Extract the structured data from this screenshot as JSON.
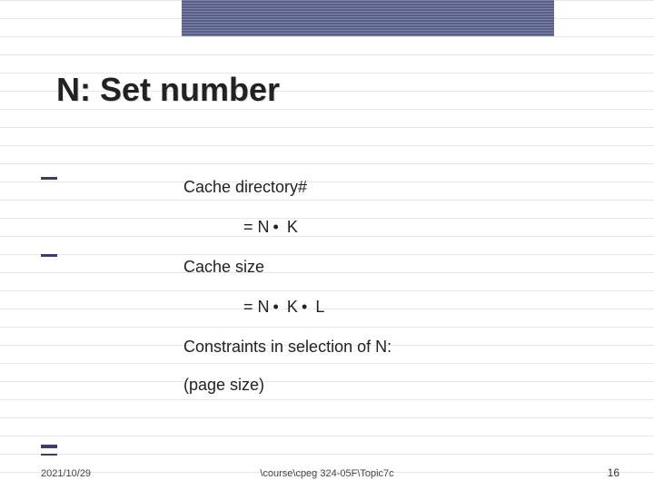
{
  "title": "N: Set number",
  "lines": {
    "l1": "Cache directory#",
    "l2_pre": "= N",
    "l2_post": " K",
    "l3": "Cache size",
    "l4_pre": "= N",
    "l4_mid": " K",
    "l4_post": " L",
    "l5": "Constraints in selection of N:",
    "l6": "(page size)"
  },
  "bullet": "•",
  "footer": {
    "date": "2021/10/29",
    "path": "\\course\\cpeg 324-05F\\Topic7c",
    "page": "16"
  }
}
